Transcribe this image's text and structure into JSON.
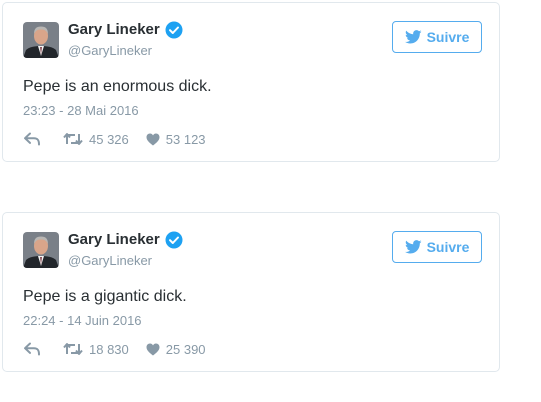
{
  "tweets": [
    {
      "name": "Gary Lineker",
      "handle": "@GaryLineker",
      "follow_label": "Suivre",
      "text": "Pepe is an enormous dick.",
      "timestamp": "23:23 - 28 Mai 2016",
      "retweets": "45 326",
      "likes": "53 123"
    },
    {
      "name": "Gary Lineker",
      "handle": "@GaryLineker",
      "follow_label": "Suivre",
      "text": "Pepe is a gigantic dick.",
      "timestamp": "22:24 - 14 Juin 2016",
      "retweets": "18 830",
      "likes": "25 390"
    }
  ],
  "icons": {
    "avatar": "avatar-photo",
    "verified": "verified-badge-icon",
    "follow": "twitter-bird-icon",
    "reply": "reply-icon",
    "retweet": "retweet-icon",
    "like": "heart-icon"
  },
  "colors": {
    "accent": "#55acee",
    "text": "#292f33",
    "muted": "#8899a6",
    "border": "#e1e8ed",
    "verified": "#1da1f2"
  }
}
